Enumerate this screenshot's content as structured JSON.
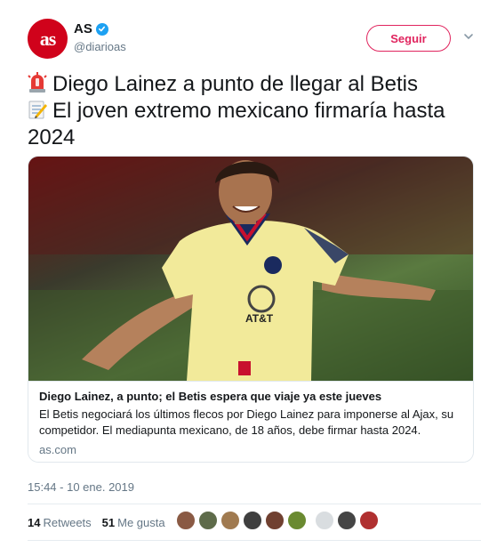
{
  "account": {
    "name": "AS",
    "handle": "@diarioas",
    "avatar_text": "as",
    "verified": true,
    "brand_color": "#d0021b"
  },
  "follow_button": {
    "label": "Seguir",
    "color": "#e0245e"
  },
  "tweet": {
    "line1_emoji": "rotating-light-icon",
    "line1": "Diego Lainez a punto de llegar al Betis",
    "line2_emoji": "memo-icon",
    "line2": "El joven extremo mexicano firmaría hasta",
    "line3": "2024"
  },
  "card": {
    "title": "Diego Lainez, a punto; el Betis espera que viaje ya este jueves",
    "description": "El Betis negociará los últimos flecos por Diego Lainez para imponerse al Ajax, su competidor. El mediapunta mexicano, de 18 años, debe firmar hasta 2024.",
    "domain": "as.com",
    "shirt_sponsor": "AT&T"
  },
  "timestamp": "15:44 - 10 ene. 2019",
  "stats": {
    "retweets_count": "14",
    "retweets_label": "Retweets",
    "likes_count": "51",
    "likes_label": "Me gusta"
  },
  "liker_colors": [
    "#8a5a44",
    "#5e6b4a",
    "#a07a50",
    "#3f3f3f",
    "#704030",
    "#6a8a30",
    "#d9dde0",
    "#454545",
    "#b03030"
  ]
}
